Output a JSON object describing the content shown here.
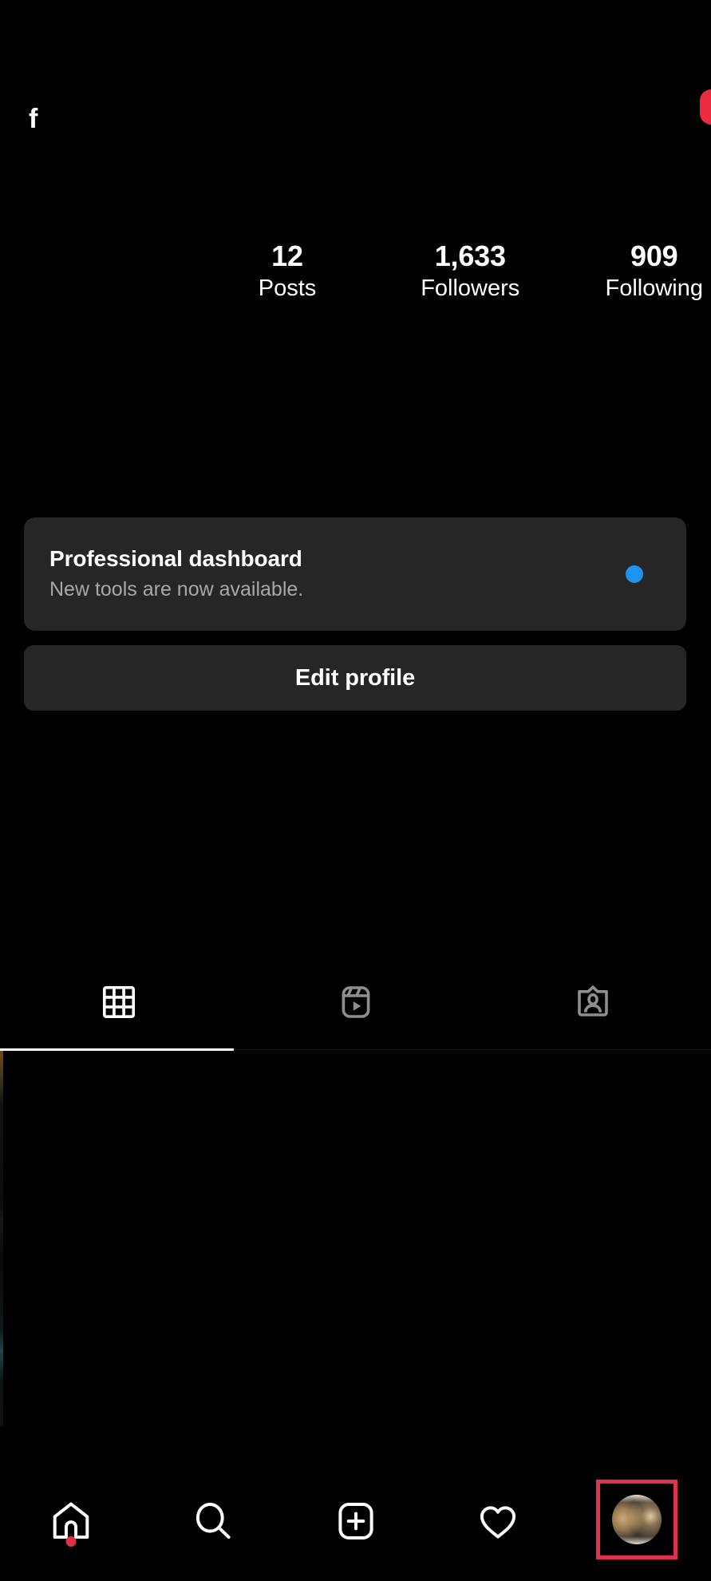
{
  "app": {
    "name": "Instagram",
    "theme": "dark",
    "background_color": "#000000"
  },
  "header": {
    "username_fragment": "f",
    "badge_icon": "partial-red-badge-icon",
    "badge_color": "#ED2B3E"
  },
  "stats": [
    {
      "value": "12",
      "label": "Posts",
      "name": "posts"
    },
    {
      "value": "1,633",
      "label": "Followers",
      "name": "followers"
    },
    {
      "value": "909",
      "label": "Following",
      "name": "following"
    }
  ],
  "professional_dashboard": {
    "title": "Professional dashboard",
    "subtitle": "New tools are now available.",
    "badge_icon": "blue-dot-icon",
    "badge_color": "#1E93F0",
    "background_color": "#262626"
  },
  "actions": {
    "edit_profile_label": "Edit profile",
    "background_color": "#262626"
  },
  "profile_tabs": {
    "active_index": 0,
    "items": [
      {
        "icon": "grid-icon",
        "label": "Posts",
        "active": true
      },
      {
        "icon": "reels-icon",
        "label": "Reels",
        "active": false
      },
      {
        "icon": "tagged-icon",
        "label": "Tagged",
        "active": false
      }
    ],
    "active_indicator_color": "#ffffff",
    "inactive_icon_color": "#8e8e8e"
  },
  "bottom_nav": {
    "items": [
      {
        "icon": "home-icon",
        "label": "Home",
        "active": false,
        "badge": true
      },
      {
        "icon": "search-icon",
        "label": "Search",
        "active": false,
        "badge": false
      },
      {
        "icon": "create-icon",
        "label": "Create",
        "active": false,
        "badge": false
      },
      {
        "icon": "heart-icon",
        "label": "Likes",
        "active": false,
        "badge": false
      },
      {
        "icon": "avatar-icon",
        "label": "Profile",
        "active": true,
        "badge": false
      }
    ],
    "home_badge_color": "#E0314A",
    "selection_highlight_color": "#E03050"
  }
}
